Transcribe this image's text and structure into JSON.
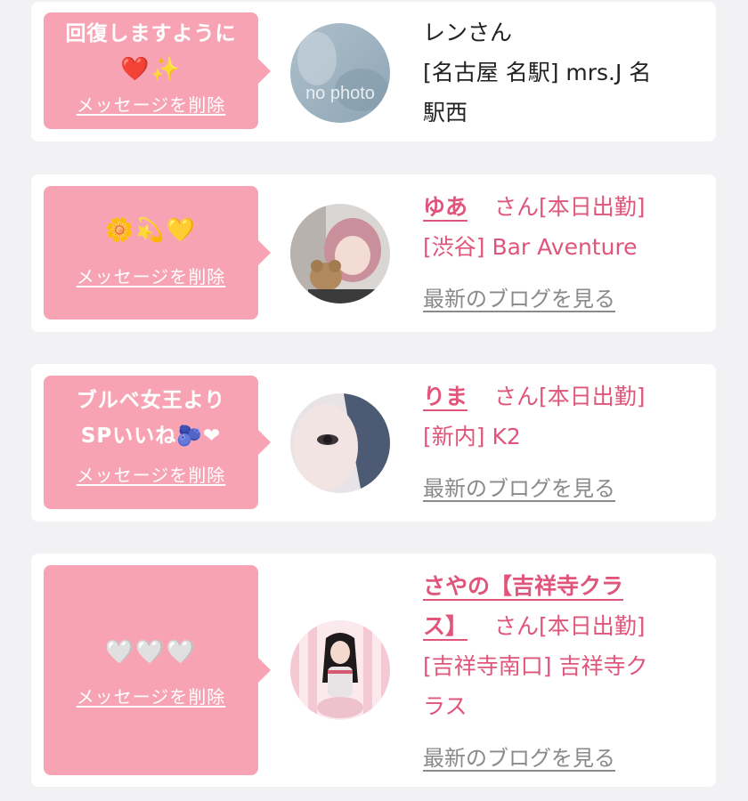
{
  "colors": {
    "background": "#f2f2f4",
    "card": "#ffffff",
    "bubble": "#f7a3b3",
    "accent": "#e0557b",
    "muted": "#8a8a8a"
  },
  "messages": [
    {
      "bubble_line1": "回復しますように",
      "bubble_line2": "❤️✨",
      "delete_label": "メッセージを削除",
      "avatar_label": "no photo",
      "name_plain": "レンさん",
      "place_line1": "[名古屋 名駅] mrs.J 名",
      "place_line2": "駅西"
    },
    {
      "bubble_emoji": "🌼💫💛",
      "delete_label": "メッセージを削除",
      "name": "ゆあ",
      "honorific": "さん[本日出勤]",
      "place": "[渋谷] Bar Aventure",
      "blog_label": "最新のブログを見る"
    },
    {
      "bubble_line1": "ブルベ女王より",
      "bubble_line2": "SPいいね🫐❤",
      "delete_label": "メッセージを削除",
      "name": "りま",
      "honorific": "さん[本日出勤]",
      "place": "[新内] K2",
      "blog_label": "最新のブログを見る"
    },
    {
      "bubble_emoji": "🤍🤍🤍",
      "delete_label": "メッセージを削除",
      "name_line1": "さやの【吉祥寺クラ",
      "name_line2": "ス】",
      "honorific": "さん[本日出勤]",
      "place_line1": "[吉祥寺南口] 吉祥寺ク",
      "place_line2": "ラス",
      "blog_label": "最新のブログを見る"
    }
  ]
}
